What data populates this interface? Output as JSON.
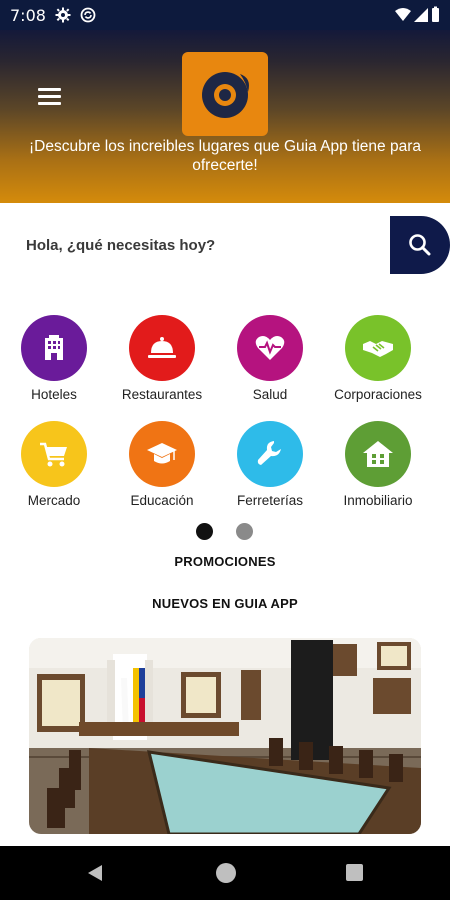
{
  "status_bar": {
    "time": "7:08",
    "icons": [
      "gear-icon",
      "sync-icon",
      "wifi-icon",
      "signal-icon",
      "battery-icon"
    ]
  },
  "header": {
    "menu_icon": "hamburger-menu-icon",
    "logo_icon": "guia-app-logo-icon",
    "tagline": "¡Descubre los increibles lugares que Guia App tiene para ofrecerte!",
    "gradient_colors": [
      "#14193a",
      "#d48b0b"
    ]
  },
  "search": {
    "placeholder": "Hola, ¿qué necesitas hoy?",
    "button_icon": "search-icon",
    "button_color": "#0f1a4a"
  },
  "categories": [
    {
      "label": "Hoteles",
      "icon": "hotel-icon",
      "color": "#6a1b9a"
    },
    {
      "label": "Restaurantes",
      "icon": "serving-bell-icon",
      "color": "#e21b1b"
    },
    {
      "label": "Salud",
      "icon": "heartbeat-icon",
      "color": "#b5137f"
    },
    {
      "label": "Corporaciones",
      "icon": "handshake-icon",
      "color": "#79c22a"
    },
    {
      "label": "Mercado",
      "icon": "shopping-cart-icon",
      "color": "#f7c51b"
    },
    {
      "label": "Educación",
      "icon": "graduation-cap-icon",
      "color": "#f07414"
    },
    {
      "label": "Ferreterías",
      "icon": "wrench-icon",
      "color": "#2ebbe9"
    },
    {
      "label": "Inmobiliario",
      "icon": "house-icon",
      "color": "#5e9e35"
    }
  ],
  "pager": {
    "dots": 2,
    "active_index": 0,
    "active_color": "#111111",
    "inactive_color": "#8a8a8a"
  },
  "sections": {
    "promotions": "PROMOCIONES",
    "new_in_app": "NUEVOS EN GUIA APP"
  },
  "featured_image": "historic-meeting-hall-image",
  "nav_bar": {
    "icons": [
      "back-icon",
      "home-icon",
      "recents-icon"
    ]
  }
}
